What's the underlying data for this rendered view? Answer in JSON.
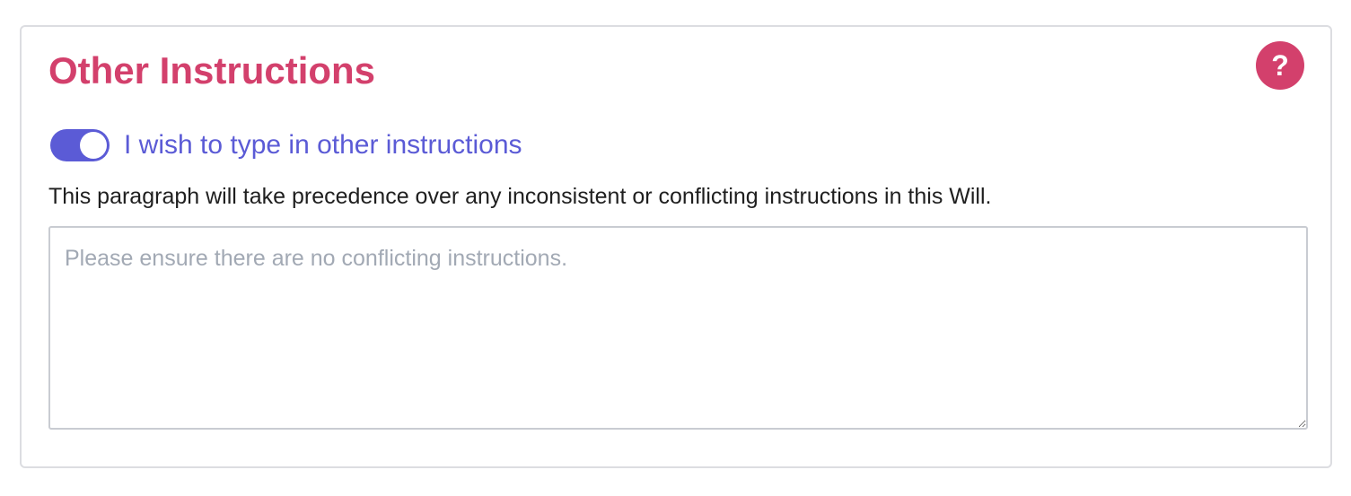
{
  "section": {
    "title": "Other Instructions",
    "help_icon": "question-mark-icon",
    "help_label": "?"
  },
  "toggle": {
    "label": "I wish to type in other instructions",
    "checked": true,
    "accent_color": "#5b5bd6"
  },
  "note": {
    "text": "This paragraph will take precedence over any inconsistent or conflicting instructions in this Will."
  },
  "instructions": {
    "value": "",
    "placeholder": "Please ensure there are no conflicting instructions."
  },
  "colors": {
    "title": "#d3406c",
    "help_button": "#d3406c",
    "toggle_accent": "#5b5bd6",
    "placeholder": "#a2a9b4"
  }
}
